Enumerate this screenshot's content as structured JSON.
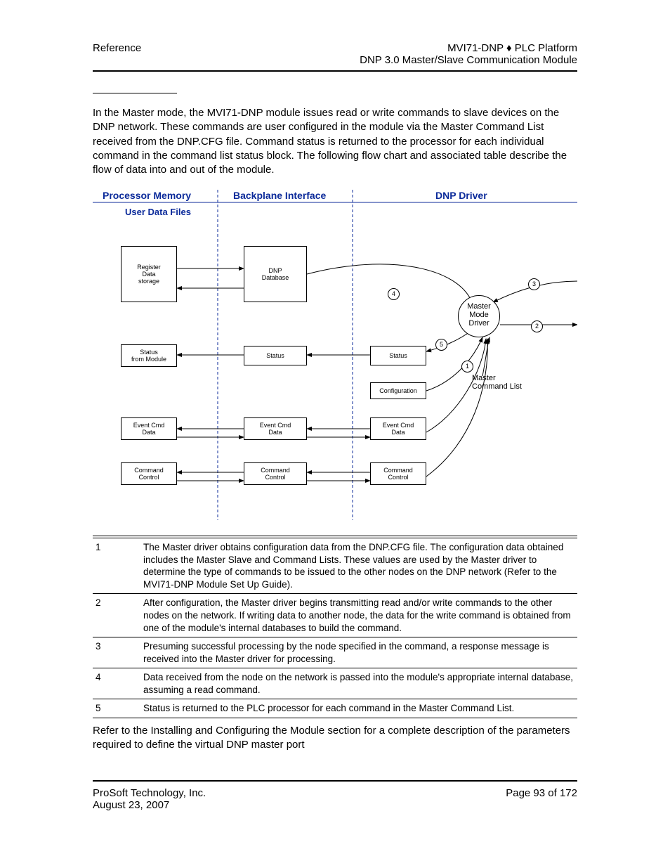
{
  "header": {
    "left": "Reference",
    "right1": "MVI71-DNP ♦ PLC Platform",
    "right2": "DNP 3.0 Master/Slave Communication Module"
  },
  "body_para": "In the Master mode, the MVI71-DNP module issues read or write commands to slave devices on the DNP network. These commands are user configured in the module via the Master Command List received from the DNP.CFG file. Command status is returned to the processor for each individual command in the command list status block. The following flow chart and associated table describe the flow of data into and out of the module.",
  "diagram": {
    "titles": {
      "c1": "Processor Memory",
      "c2": "Backplane Interface",
      "c3": "DNP Driver"
    },
    "subtitle": "User Data Files",
    "boxes": {
      "register": "Register\nData\nstorage",
      "dnp_db": "DNP\nDatabase",
      "status_from": "Status\nfrom Module",
      "status_mid": "Status",
      "status_right": "Status",
      "config": "Configuration",
      "eventcmd_l": "Event Cmd\nData",
      "eventcmd_m": "Event Cmd\nData",
      "eventcmd_r": "Event Cmd\nData",
      "cmdctrl_l": "Command\nControl",
      "cmdctrl_m": "Command\nControl",
      "cmdctrl_r": "Command\nControl"
    },
    "labels": {
      "master_driver": "Master\nMode\nDriver",
      "master_cmd_list": "Master\nCommand List"
    },
    "nums": {
      "n1": "1",
      "n2": "2",
      "n3": "3",
      "n4": "4",
      "n5": "5"
    }
  },
  "steps": [
    {
      "n": "1",
      "text": "The Master driver obtains configuration data from the DNP.CFG file. The configuration data obtained includes the Master Slave and Command Lists. These values are used by the Master driver to determine the type of commands to be issued to the other nodes on the DNP network (Refer to the MVI71-DNP Module Set Up Guide)."
    },
    {
      "n": "2",
      "text": "After configuration, the Master driver begins transmitting read and/or write commands to the other nodes on the network. If writing data to another node, the data for the write command is obtained from one of the module's internal databases to build the command."
    },
    {
      "n": "3",
      "text": "Presuming successful processing by the node specified in the command, a response message is received into the Master driver for processing."
    },
    {
      "n": "4",
      "text": "Data received from the node on the network is passed into the module's appropriate internal database, assuming a read command."
    },
    {
      "n": "5",
      "text": "Status is returned to the PLC processor for each command in the Master Command List."
    }
  ],
  "after_table": "Refer to the Installing and Configuring the Module section for a complete description of the parameters required to define the virtual DNP master port",
  "footer": {
    "left1": "ProSoft Technology, Inc.",
    "left2": "August 23, 2007",
    "right": "Page 93 of 172"
  }
}
